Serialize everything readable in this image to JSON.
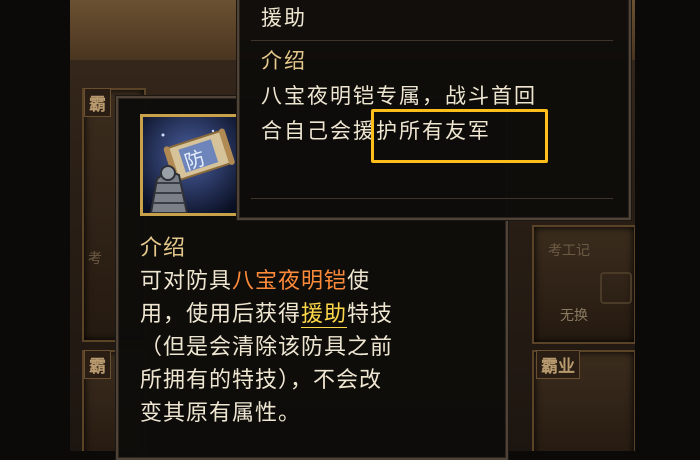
{
  "background": {
    "labels": [
      "霸",
      "霸",
      "霸业"
    ],
    "faint_texts": [
      "考工记",
      "考",
      "无换"
    ]
  },
  "skill_tooltip": {
    "title": "援助",
    "intro_heading": "介绍",
    "description_lines": [
      "八宝夜明铠专属，战斗首回",
      "合自己会援护所有友军"
    ],
    "highlighted_text": "援护所有友军",
    "highlight_color": "#ffbe19"
  },
  "item_tooltip": {
    "item_icon": "defense-scroll-armor-icon",
    "scroll_glyph": "防",
    "intro_heading": "介绍",
    "line1_a": "可对防具",
    "line1_armor": "八宝夜明铠",
    "line1_b": "使",
    "line2_a": "用，使用后获得",
    "line2_skill": "援助",
    "line2_b": "特技",
    "line3": "（但是会清除该防具之前",
    "line4": "所拥有的特技），不会改",
    "line5": "变其原有属性。",
    "armor_color": "#ff8a3a",
    "skill_color": "#ffd94a"
  }
}
